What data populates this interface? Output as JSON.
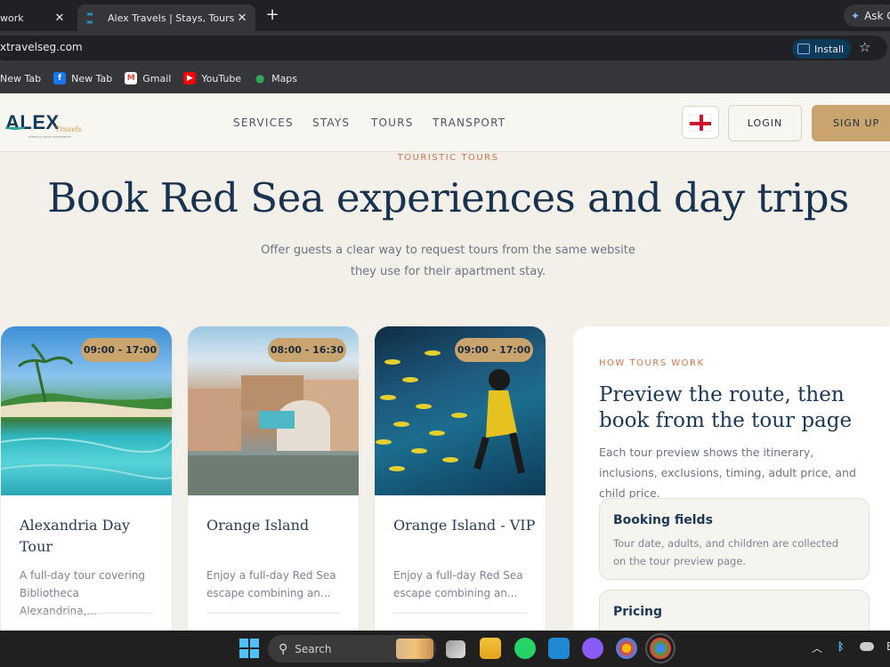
{
  "browser": {
    "tabs": [
      {
        "title": "work",
        "active": false
      },
      {
        "title": "Alex Travels | Stays, Tours & Private",
        "active": true
      }
    ],
    "new_tab_symbol": "+",
    "close_symbol": "✕",
    "ask_label": "Ask G",
    "url": "xtravelseg.com",
    "install_label": "Install",
    "star_symbol": "☆",
    "bookmarks": [
      {
        "label": "New Tab",
        "icon": "globe-icon",
        "color": "#35363a"
      },
      {
        "label": "New Tab",
        "icon": "facebook-icon",
        "color": "#1877f2"
      },
      {
        "label": "Gmail",
        "icon": "gmail-icon",
        "color": "#ea4335"
      },
      {
        "label": "YouTube",
        "icon": "youtube-icon",
        "color": "#ff0000"
      },
      {
        "label": "Maps",
        "icon": "maps-icon",
        "color": "#34a853"
      }
    ]
  },
  "site": {
    "logo": {
      "main": "ALEX",
      "sub": "Travels",
      "tagline": "PREMIUM TRAVEL EXPERIENCES"
    },
    "nav": [
      "SERVICES",
      "STAYS",
      "TOURS",
      "TRANSPORT"
    ],
    "login_label": "LOGIN",
    "signup_label": "SIGN UP",
    "accent_color": "#c9a46e",
    "hero": {
      "eyebrow": "TOURISTIC TOURS",
      "headline": "Book Red Sea experiences and day trips",
      "sub_line1": "Offer guests a clear way to request tours from the same website",
      "sub_line2": "they use for their apartment stay."
    },
    "tours": [
      {
        "time": "09:00 - 17:00",
        "title": "Alexandria Day Tour",
        "desc": "A full-day tour covering Bibliotheca Alexandrina,..."
      },
      {
        "time": "08:00 - 16:30",
        "title": "Orange Island",
        "desc": "Enjoy a full-day Red Sea escape combining an..."
      },
      {
        "time": "09:00 - 17:00",
        "title": "Orange Island - VIP",
        "desc": "Enjoy a full-day Red Sea escape combining an..."
      }
    ],
    "how": {
      "eyebrow": "HOW TOURS WORK",
      "title": "Preview the route, then book from the tour page",
      "desc": "Each tour preview shows the itinerary, inclusions, exclusions, timing, adult price, and child price.",
      "boxes": [
        {
          "heading": "Booking fields",
          "body": "Tour date, adults, and children are collected on the tour preview page."
        },
        {
          "heading": "Pricing",
          "body": ""
        }
      ]
    }
  },
  "taskbar": {
    "search_label": "Search"
  }
}
